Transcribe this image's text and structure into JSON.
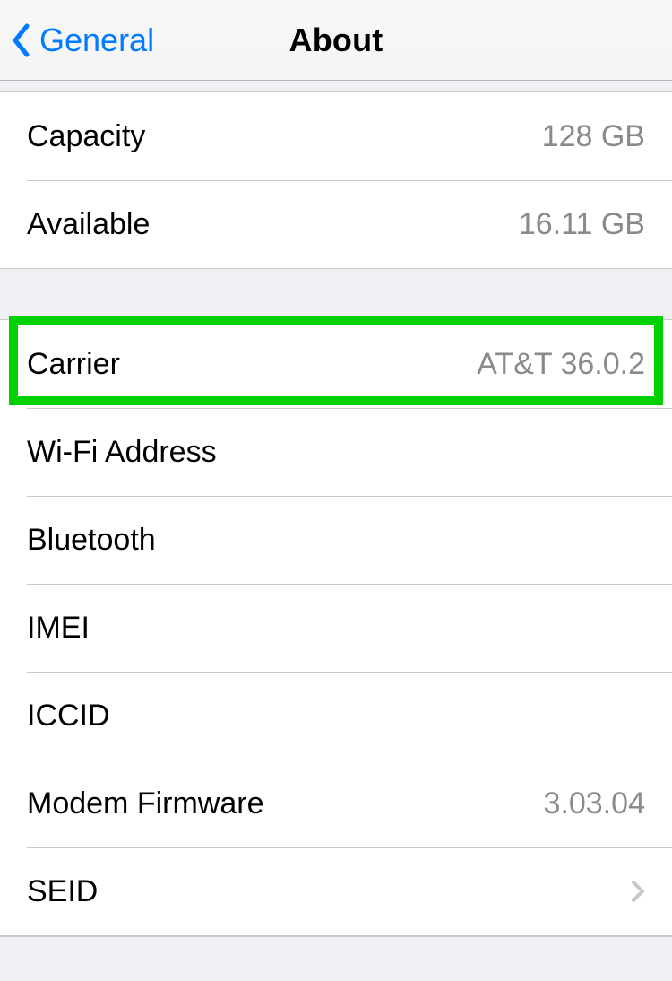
{
  "nav": {
    "back_label": "General",
    "title": "About"
  },
  "group_storage": [
    {
      "label": "Capacity",
      "value": "128 GB"
    },
    {
      "label": "Available",
      "value": "16.11 GB"
    }
  ],
  "group_network": [
    {
      "label": "Carrier",
      "value": "AT&T 36.0.2",
      "highlight": true
    },
    {
      "label": "Wi-Fi Address",
      "value": ""
    },
    {
      "label": "Bluetooth",
      "value": ""
    },
    {
      "label": "IMEI",
      "value": ""
    },
    {
      "label": "ICCID",
      "value": ""
    },
    {
      "label": "Modem Firmware",
      "value": "3.03.04"
    },
    {
      "label": "SEID",
      "value": "",
      "disclosure": true
    }
  ],
  "colors": {
    "tint": "#007aff",
    "value_gray": "#8a8a8e",
    "highlight": "#00d000"
  }
}
